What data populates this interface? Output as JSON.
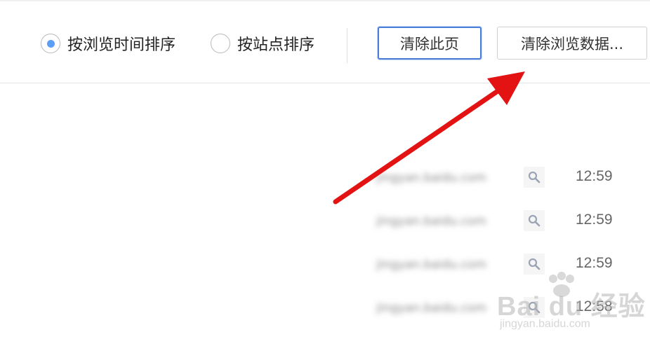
{
  "sort_options": [
    {
      "label": "按浏览时间排序",
      "selected": true
    },
    {
      "label": "按站点排序",
      "selected": false
    }
  ],
  "buttons": {
    "clear_page": "清除此页",
    "clear_data": "清除浏览数据..."
  },
  "history": [
    {
      "url": "jingyan.baidu.com",
      "time": "12:59"
    },
    {
      "url": "jingyan.baidu.com",
      "time": "12:59"
    },
    {
      "url": "jingyan.baidu.com",
      "time": "12:59"
    },
    {
      "url": "jingyan.baidu.com",
      "time": "12:58"
    }
  ],
  "watermark": {
    "brand": "Bai du 经验",
    "site": "jingyan.baidu.com"
  },
  "colors": {
    "arrow": "#e31313",
    "radio_selected": "#5b9ef3",
    "primary_border": "#4a7fd8"
  }
}
